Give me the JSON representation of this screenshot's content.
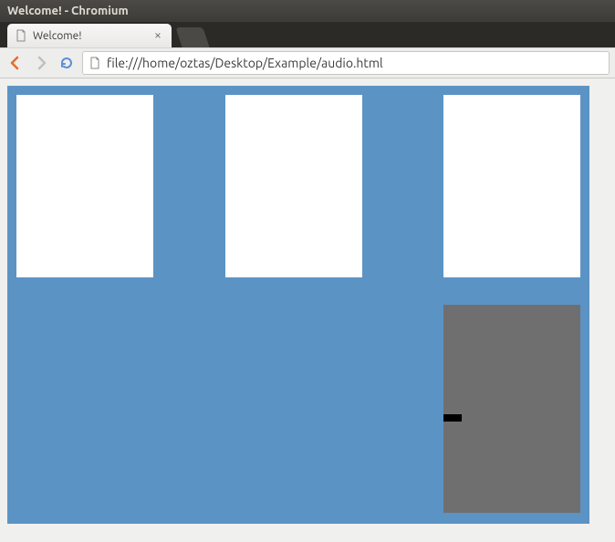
{
  "window": {
    "title": "Welcome! - Chromium"
  },
  "tab": {
    "title": "Welcome!"
  },
  "toolbar": {
    "back_enabled": true,
    "forward_enabled": false,
    "url": "file:///home/oztas/Desktop/Example/audio.html"
  },
  "icons": {
    "back": "back-arrow-icon",
    "forward": "forward-arrow-icon",
    "reload": "reload-icon",
    "file": "file-icon",
    "close": "close-icon"
  },
  "colors": {
    "page_bg": "#5c93c5",
    "box_bg": "#ffffff",
    "grey_box_bg": "#6f6f6f"
  }
}
